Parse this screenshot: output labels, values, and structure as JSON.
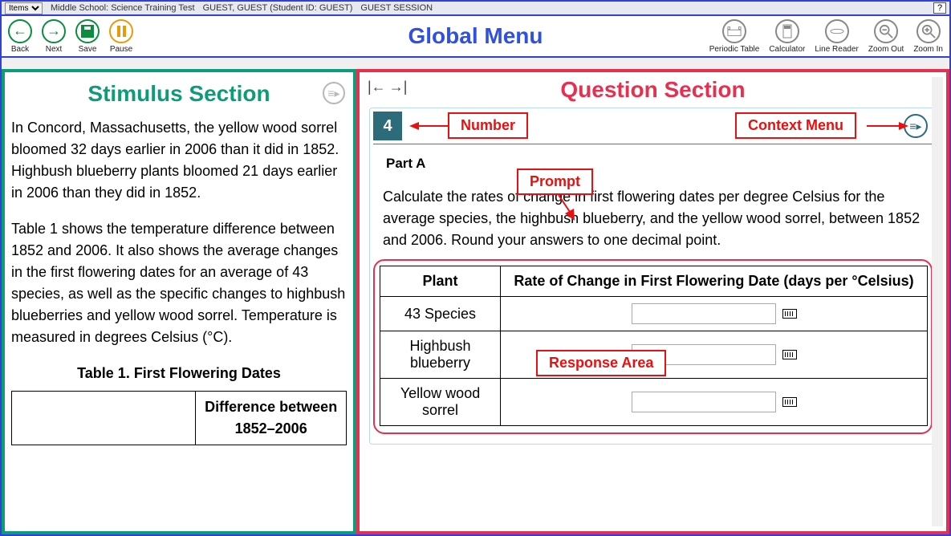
{
  "topbar": {
    "items_label": "Items",
    "test_name": "Middle School: Science Training Test",
    "student": "GUEST, GUEST (Student ID: GUEST)",
    "session": "GUEST SESSION",
    "help_label": "?"
  },
  "global_menu": {
    "title": "Global Menu",
    "left": {
      "back": "Back",
      "next": "Next",
      "save": "Save",
      "pause": "Pause"
    },
    "right": {
      "periodic": "Periodic Table",
      "calculator": "Calculator",
      "line_reader": "Line Reader",
      "zoom_out": "Zoom Out",
      "zoom_in": "Zoom In"
    }
  },
  "stimulus": {
    "section_title": "Stimulus Section",
    "para1": "In Concord, Massachusetts, the yellow wood sorrel bloomed 32 days earlier in 2006 than it did in 1852. Highbush blueberry plants bloomed 21 days earlier in 2006 than they did in 1852.",
    "para2": "Table 1 shows the temperature difference between 1852 and 2006. It also shows the average changes in the first flowering dates for an average of 43 species, as well as the specific changes to highbush blueberries and yellow wood sorrel. Temperature is measured in degrees Celsius (°C).",
    "table_title": "Table 1. First Flowering Dates",
    "table_col2": "Difference between 1852–2006"
  },
  "question": {
    "section_title": "Question Section",
    "number": "4",
    "part_label": "Part A",
    "prompt": "Calculate the rates of change in first flowering dates per degree Celsius for the average species, the highbush blueberry, and the yellow wood sorrel, between 1852 and 2006. Round your answers to one decimal point.",
    "table": {
      "col1": "Plant",
      "col2": "Rate of Change in First Flowering Date (days per °Celsius)",
      "rows": {
        "r1": "43 Species",
        "r2": "Highbush blueberry",
        "r3": "Yellow wood sorrel"
      }
    }
  },
  "labels": {
    "number": "Number",
    "context_menu": "Context Menu",
    "prompt": "Prompt",
    "response_area": "Response Area"
  }
}
